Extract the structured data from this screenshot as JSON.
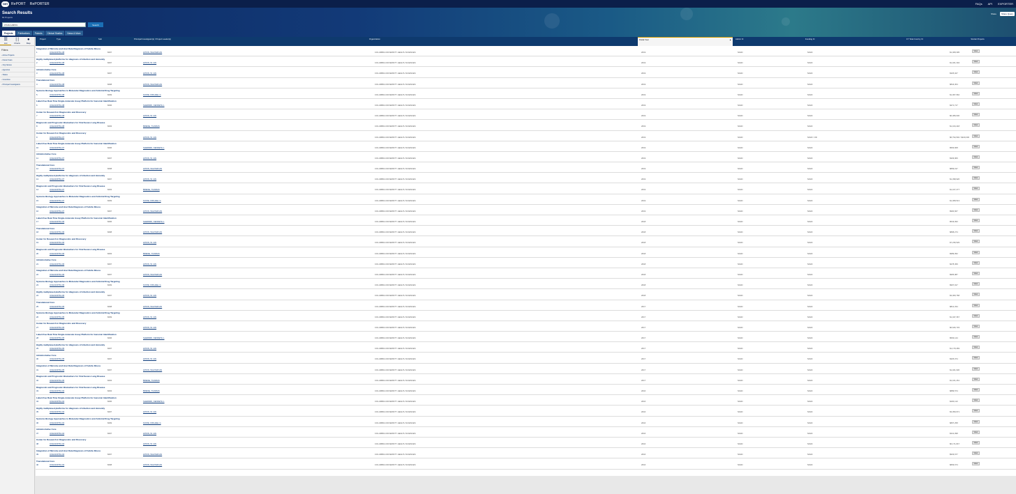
{
  "topnav": {
    "logo": "NIH",
    "brand1": "RePORT",
    "brand2": "RePORTER",
    "links": [
      "FAQs",
      "API",
      "EXPORTER"
    ]
  },
  "hero": {
    "title": "Search Results",
    "subtitle": "82 Projects",
    "search_value": "#7R&CH8PR1",
    "search_button": "Search",
    "tools": [
      "Share",
      "Share Query"
    ]
  },
  "tabs": [
    {
      "label": "Projects",
      "active": true
    },
    {
      "label": "Publications",
      "active": false
    },
    {
      "label": "Patents",
      "active": false
    },
    {
      "label": "Clinical Studies",
      "active": false
    },
    {
      "label": "News & More",
      "active": false
    }
  ],
  "views": [
    {
      "label": "List",
      "icon": "list-icon"
    },
    {
      "label": "Charts",
      "icon": "chart-icon"
    },
    {
      "label": "Map",
      "icon": "map-pin-icon"
    }
  ],
  "filters": {
    "title": "Filters",
    "items": [
      "Active Projects",
      "Fiscal Years",
      "Org Names",
      "Agencies",
      "States",
      "Countries",
      "Principal Investigators"
    ]
  },
  "columns": {
    "project": "Project",
    "type": "Type",
    "sub": "Sub",
    "pi": "Principal Investigator(s) / Project Leader(s)",
    "org": "Organization",
    "fy": "Fiscal Year",
    "admin": "Admin IC",
    "funding": "Funding IC",
    "cost": "FY Total Cost by IC",
    "similar": "Similar Projects"
  },
  "rows": [
    {
      "title": "Integration of Microbe and Host Data Diagnosis of Febrile Illness",
      "idx": "1",
      "project": "U19AI109761-08",
      "sub": "8497",
      "pi": "LIPKIN, WALTER IAN",
      "org": "COLUMBIA UNIVERSITY HEALTH SCIENCES",
      "fy": "2019",
      "admin": "NIAID",
      "funding": "NIAID",
      "cost": "$1,008,395",
      "view": "View"
    },
    {
      "title": "Highly multiplexed platforms for diagnosis of infection and immunity",
      "idx": "2",
      "project": "U19AI109761-08",
      "sub": "8497",
      "pi": "LIPKIN, W. IAN",
      "org": "COLUMBIA UNIVERSITY HEALTH SCIENCES",
      "fy": "2019",
      "admin": "NIAID",
      "funding": "NIAID",
      "cost": "$1,461,304",
      "view": "View"
    },
    {
      "title": "Administrative Core",
      "idx": "3",
      "project": "U19AI109761-08",
      "sub": "8497",
      "pi": "LIPKIN, W. IAN",
      "org": "COLUMBIA UNIVERSITY HEALTH SCIENCES",
      "fy": "2019",
      "admin": "NIAID",
      "funding": "NIAID",
      "cost": "$325,027",
      "view": "View"
    },
    {
      "title": "Translational Core",
      "idx": "4",
      "project": "U19AI109761-08",
      "sub": "8498",
      "pi": "LIPKIN, WALTER IAN",
      "org": "COLUMBIA UNIVERSITY HEALTH SCIENCES",
      "fy": "2019",
      "admin": "NIAID",
      "funding": "NIAID",
      "cost": "$844,304",
      "view": "View"
    },
    {
      "title": "Systems Biology Approaches to Molecular Diagnostics and Antiviral Drug Targeting",
      "idx": "5",
      "project": "U19AI109761-08",
      "sub": "8499",
      "pi": "KATZE, MICHAEL G",
      "org": "COLUMBIA UNIVERSITY HEALTH SCIENCES",
      "fy": "2019",
      "admin": "NIAID",
      "funding": "NIAID",
      "cost": "$1,067,962",
      "view": "View"
    },
    {
      "title": "Label-Free Real-Time Single-molecule Assay Platform for Genomic Identification",
      "idx": "6",
      "project": "U19AI109761-08",
      "sub": "8496",
      "pi": "SHEPARD, KENNETH L",
      "org": "COLUMBIA UNIVERSITY HEALTH SCIENCES",
      "fy": "2019",
      "admin": "NIAID",
      "funding": "NIAID",
      "cost": "$471,717",
      "view": "View"
    },
    {
      "title": "Center for Research in Diagnostics and Discovery",
      "idx": "7",
      "project": "U19AI109761-08",
      "sub": "",
      "pi": "LIPKIN, W. IAN",
      "org": "COLUMBIA UNIVERSITY HEALTH SCIENCES",
      "fy": "2019",
      "admin": "NIAID",
      "funding": "NIAID",
      "cost": "$6,389,630",
      "view": "View"
    },
    {
      "title": "Diagnostic and Prognostic Biomarkers for Viral Severe Lung Disease",
      "idx": "8",
      "project": "U19AI109761-08",
      "sub": "8493",
      "pi": "BRIESE, THOMAS",
      "org": "COLUMBIA UNIVERSITY HEALTH SCIENCES",
      "fy": "2019",
      "admin": "NIAID",
      "funding": "NIAID",
      "cost": "$1,164,418",
      "view": "View"
    },
    {
      "title": "Center for Research in Diagnostics and Discovery",
      "idx": "9",
      "project": "U19AI109761-07",
      "sub": "",
      "pi": "LIPKIN, W. IAN",
      "org": "COLUMBIA UNIVERSITY HEALTH SCIENCES",
      "fy": "2019",
      "admin": "NIAID",
      "funding": "NIAID / OD",
      "cost": "$6,794,540 / $100,000",
      "view": "View"
    },
    {
      "title": "Label-Free Real-Time Single-molecule Assay Platform for Genomic Identification",
      "idx": "10",
      "project": "U19AI109761-07",
      "sub": "8496",
      "pi": "SHEPARD, KENNETH L",
      "org": "COLUMBIA UNIVERSITY HEALTH SCIENCES",
      "fy": "2019",
      "admin": "NIAID",
      "funding": "NIAID",
      "cost": "$563,608",
      "view": "View"
    },
    {
      "title": "Administrative Core",
      "idx": "11",
      "project": "U19AI109761-07",
      "sub": "8497",
      "pi": "LIPKIN, W. IAN",
      "org": "COLUMBIA UNIVERSITY HEALTH SCIENCES",
      "fy": "2019",
      "admin": "NIAID",
      "funding": "NIAID",
      "cost": "$329,906",
      "view": "View"
    },
    {
      "title": "Translational Core",
      "idx": "12",
      "project": "U19AI109761-07",
      "sub": "8498",
      "pi": "LIPKIN, WALTER IAN",
      "org": "COLUMBIA UNIVERSITY HEALTH SCIENCES",
      "fy": "2019",
      "admin": "NIAID",
      "funding": "NIAID",
      "cost": "$899,197",
      "view": "View"
    },
    {
      "title": "Highly multiplexed platforms for diagnosis of infection and immunity",
      "idx": "13",
      "project": "U19AI109761-07",
      "sub": "8497",
      "pi": "LIPKIN, W. IAN",
      "org": "COLUMBIA UNIVERSITY HEALTH SCIENCES",
      "fy": "2019",
      "admin": "NIAID",
      "funding": "NIAID",
      "cost": "$1,398,926",
      "view": "View"
    },
    {
      "title": "Diagnostic and Prognostic Biomarkers for Viral Severe Lung Disease",
      "idx": "14",
      "project": "U19AI109761-07",
      "sub": "8493",
      "pi": "BRIESE, THOMAS",
      "org": "COLUMBIA UNIVERSITY HEALTH SCIENCES",
      "fy": "2019",
      "admin": "NIAID",
      "funding": "NIAID",
      "cost": "$1,107,277",
      "view": "View"
    },
    {
      "title": "Systems Biology Approaches to Molecular Diagnostics and Antiviral Drug Targeting",
      "idx": "15",
      "project": "U19AI109761-07",
      "sub": "8499",
      "pi": "KATZE, MICHAEL G",
      "org": "COLUMBIA UNIVERSITY HEALTH SCIENCES",
      "fy": "2019",
      "admin": "NIAID",
      "funding": "NIAID",
      "cost": "$1,068,513",
      "view": "View"
    },
    {
      "title": "Integration of Microbe and Host Data Diagnosis of Febrile Illness",
      "idx": "16",
      "project": "U19AI109761-07",
      "sub": "8497",
      "pi": "LIPKIN, WALTER IAN",
      "org": "COLUMBIA UNIVERSITY HEALTH SCIENCES",
      "fy": "2019",
      "admin": "NIAID",
      "funding": "NIAID",
      "cost": "$900,667",
      "view": "View"
    },
    {
      "title": "Label-Free Real-Time Single-molecule Assay Platform for Genomic Identification",
      "idx": "17",
      "project": "U19AI109761-06",
      "sub": "8496",
      "pi": "SHEPARD, KENNETH L",
      "org": "COLUMBIA UNIVERSITY HEALTH SCIENCES",
      "fy": "2018",
      "admin": "NIAID",
      "funding": "NIAID",
      "cost": "$543,093",
      "view": "View"
    },
    {
      "title": "Translational Core",
      "idx": "18",
      "project": "U19AI109761-06",
      "sub": "8498",
      "pi": "LIPKIN, WALTER IAN",
      "org": "COLUMBIA UNIVERSITY HEALTH SCIENCES",
      "fy": "2018",
      "admin": "NIAID",
      "funding": "NIAID",
      "cost": "$868,274",
      "view": "View"
    },
    {
      "title": "Center for Research in Diagnostics and Discovery",
      "idx": "19",
      "project": "U19AI109761-06",
      "sub": "",
      "pi": "LIPKIN, W. IAN",
      "org": "COLUMBIA UNIVERSITY HEALTH SCIENCES",
      "fy": "2018",
      "admin": "NIAID",
      "funding": "NIAID",
      "cost": "$7,236,529",
      "view": "View"
    },
    {
      "title": "Diagnostic and Prognostic Biomarkers for Viral Severe Lung Disease",
      "idx": "20",
      "project": "U19AI109761-06",
      "sub": "8493",
      "pi": "BRIESE, THOMAS",
      "org": "COLUMBIA UNIVERSITY HEALTH SCIENCES",
      "fy": "2018",
      "admin": "NIAID",
      "funding": "NIAID",
      "cost": "$989,052",
      "view": "View"
    },
    {
      "title": "Administrative Core",
      "idx": "21",
      "project": "U19AI109761-06",
      "sub": "8497",
      "pi": "LIPKIN, W. IAN",
      "org": "COLUMBIA UNIVERSITY HEALTH SCIENCES",
      "fy": "2018",
      "admin": "NIAID",
      "funding": "NIAID",
      "cost": "$278,459",
      "view": "View"
    },
    {
      "title": "Integration of Microbe and Host Data Diagnosis of Febrile Illness",
      "idx": "22",
      "project": "U19AI109761-06",
      "sub": "8497",
      "pi": "LIPKIN, WALTER IAN",
      "org": "COLUMBIA UNIVERSITY HEALTH SCIENCES",
      "fy": "2018",
      "admin": "NIAID",
      "funding": "NIAID",
      "cost": "$965,987",
      "view": "View"
    },
    {
      "title": "Systems Biology Approaches to Molecular Diagnostics and Antiviral Drug Targeting",
      "idx": "23",
      "project": "U19AI109761-06",
      "sub": "8499",
      "pi": "KATZE, MICHAEL G",
      "org": "COLUMBIA UNIVERSITY HEALTH SCIENCES",
      "fy": "2018",
      "admin": "NIAID",
      "funding": "NIAID",
      "cost": "$997,917",
      "view": "View"
    },
    {
      "title": "Highly multiplexed platforms for diagnosis of infection and immunity",
      "idx": "24",
      "project": "U19AI109761-06",
      "sub": "8497",
      "pi": "LIPKIN, W. IAN",
      "org": "COLUMBIA UNIVERSITY HEALTH SCIENCES",
      "fy": "2018",
      "admin": "NIAID",
      "funding": "NIAID",
      "cost": "$3,009,768",
      "view": "View"
    },
    {
      "title": "Translational Core",
      "idx": "25",
      "project": "U19AI109761-05",
      "sub": "8498",
      "pi": "LIPKIN, WALTER IAN",
      "org": "COLUMBIA UNIVERSITY HEALTH SCIENCES",
      "fy": "2017",
      "admin": "NIAID",
      "funding": "NIAID",
      "cost": "$812,334",
      "view": "View"
    },
    {
      "title": "Systems Biology Approaches to Molecular Diagnostics and Antiviral Drug Targeting",
      "idx": "26",
      "project": "U19AI109761-05",
      "sub": "8499",
      "pi": "LIPKIN, W. IAN",
      "org": "COLUMBIA UNIVERSITY HEALTH SCIENCES",
      "fy": "2017",
      "admin": "NIAID",
      "funding": "NIAID",
      "cost": "$1,047,367",
      "view": "View"
    },
    {
      "title": "Center for Research in Diagnostics and Discovery",
      "idx": "27",
      "project": "U19AI109761-05",
      "sub": "",
      "pi": "LIPKIN, W. IAN",
      "org": "COLUMBIA UNIVERSITY HEALTH SCIENCES",
      "fy": "2017",
      "admin": "NIAID",
      "funding": "NIAID",
      "cost": "$6,626,733",
      "view": "View"
    },
    {
      "title": "Label-Free Real-Time Single-molecule Assay Platform for Genomic Identification",
      "idx": "28",
      "project": "U19AI109761-05",
      "sub": "8496",
      "pi": "SHEPARD, KENNETH L",
      "org": "COLUMBIA UNIVERSITY HEALTH SCIENCES",
      "fy": "2017",
      "admin": "NIAID",
      "funding": "NIAID",
      "cost": "$593,144",
      "view": "View"
    },
    {
      "title": "Highly multiplexed platforms for diagnosis of infection and immunity",
      "idx": "29",
      "project": "U19AI109761-05",
      "sub": "8497",
      "pi": "LIPKIN, W. IAN",
      "org": "COLUMBIA UNIVERSITY HEALTH SCIENCES",
      "fy": "2017",
      "admin": "NIAID",
      "funding": "NIAID",
      "cost": "$1,179,469",
      "view": "View"
    },
    {
      "title": "Administrative Core",
      "idx": "30",
      "project": "U19AI109761-05",
      "sub": "8497",
      "pi": "LIPKIN, W. IAN",
      "org": "COLUMBIA UNIVERSITY HEALTH SCIENCES",
      "fy": "2017",
      "admin": "NIAID",
      "funding": "NIAID",
      "cost": "$325,074",
      "view": "View"
    },
    {
      "title": "Integration of Microbe and Host Data Diagnosis of Febrile Illness",
      "idx": "31",
      "project": "U19AI109761-05",
      "sub": "8497",
      "pi": "LIPKIN, WALTER IAN",
      "org": "COLUMBIA UNIVERSITY HEALTH SCIENCES",
      "fy": "2017",
      "admin": "NIAID",
      "funding": "NIAID",
      "cost": "$1,461,936",
      "view": "View"
    },
    {
      "title": "Diagnostic and Prognostic Biomarkers for Viral Severe Lung Disease",
      "idx": "32",
      "project": "U19AI109761-05",
      "sub": "8493",
      "pi": "BRIESE, THOMAS",
      "org": "COLUMBIA UNIVERSITY HEALTH SCIENCES",
      "fy": "2017",
      "admin": "NIAID",
      "funding": "NIAID",
      "cost": "$1,101,261",
      "view": "View"
    },
    {
      "title": "Diagnostic and Prognostic Biomarkers for Viral Severe Lung Disease",
      "idx": "33",
      "project": "U19AI109761-04",
      "sub": "8493",
      "pi": "BRIESE, THOMAS",
      "org": "COLUMBIA UNIVERSITY HEALTH SCIENCES",
      "fy": "2016",
      "admin": "NIAID",
      "funding": "NIAID",
      "cost": "$889,574",
      "view": "View"
    },
    {
      "title": "Label-Free Real-Time Single-molecule Assay Platform for Genomic Identification",
      "idx": "34",
      "project": "U19AI109761-04",
      "sub": "8496",
      "pi": "SHEPARD, KENNETH L",
      "org": "COLUMBIA UNIVERSITY HEALTH SCIENCES",
      "fy": "2016",
      "admin": "NIAID",
      "funding": "NIAID",
      "cost": "$430,110",
      "view": "View"
    },
    {
      "title": "Highly multiplexed platforms for diagnosis of infection and immunity",
      "idx": "35",
      "project": "U19AI109761-04",
      "sub": "8497",
      "pi": "LIPKIN, W. IAN",
      "org": "COLUMBIA UNIVERSITY HEALTH SCIENCES",
      "fy": "2016",
      "admin": "NIAID",
      "funding": "NIAID",
      "cost": "$3,059,971",
      "view": "View"
    },
    {
      "title": "Systems Biology Approaches to Molecular Diagnostics and Antiviral Drug Targeting",
      "idx": "36",
      "project": "U19AI109761-04",
      "sub": "8499",
      "pi": "KATZE, MICHAEL G",
      "org": "COLUMBIA UNIVERSITY HEALTH SCIENCES",
      "fy": "2016",
      "admin": "NIAID",
      "funding": "NIAID",
      "cost": "$897,258",
      "view": "View"
    },
    {
      "title": "Administrative Core",
      "idx": "37",
      "project": "U19AI109761-04",
      "sub": "8497",
      "pi": "LIPKIN, W. IAN",
      "org": "COLUMBIA UNIVERSITY HEALTH SCIENCES",
      "fy": "2016",
      "admin": "NIAID",
      "funding": "NIAID",
      "cost": "$341,098",
      "view": "View"
    },
    {
      "title": "Center for Research in Diagnostics and Discovery",
      "idx": "38",
      "project": "U19AI109761-04",
      "sub": "",
      "pi": "LIPKIN, W. IAN",
      "org": "COLUMBIA UNIVERSITY HEALTH SCIENCES",
      "fy": "2016",
      "admin": "NIAID",
      "funding": "NIAID",
      "cost": "$6,171,847",
      "view": "View"
    },
    {
      "title": "Integration of Microbe and Host Data Diagnosis of Febrile Illness",
      "idx": "39",
      "project": "U19AI109761-04",
      "sub": "8497",
      "pi": "LIPKIN, WALTER IAN",
      "org": "COLUMBIA UNIVERSITY HEALTH SCIENCES",
      "fy": "2016",
      "admin": "NIAID",
      "funding": "NIAID",
      "cost": "$933,677",
      "view": "View"
    },
    {
      "title": "Translational Core",
      "idx": "40",
      "project": "U19AI109761-04",
      "sub": "8498",
      "pi": "LIPKIN, WALTER IAN",
      "org": "COLUMBIA UNIVERSITY HEALTH SCIENCES",
      "fy": "2016",
      "admin": "NIAID",
      "funding": "NIAID",
      "cost": "$809,674",
      "view": "View"
    }
  ]
}
